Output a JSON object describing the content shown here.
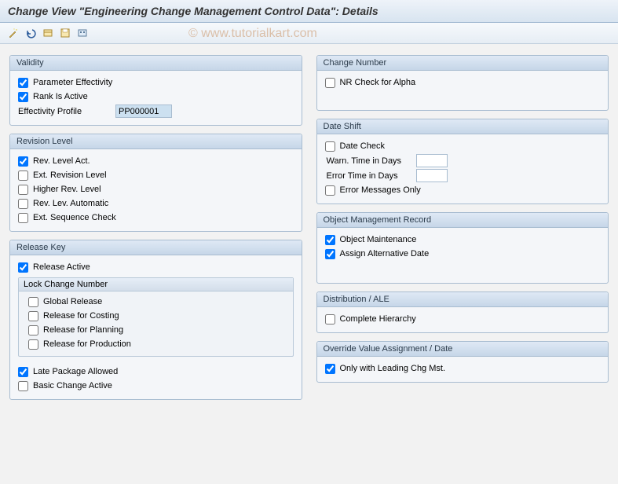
{
  "title": "Change View \"Engineering Change Management Control Data\": Details",
  "watermark": "© www.tutorialkart.com",
  "toolbar_icons": [
    "wand-icon",
    "undo-icon",
    "box-icon",
    "save-icon",
    "config-icon"
  ],
  "left": {
    "validity": {
      "header": "Validity",
      "param_effectivity": "Parameter Effectivity",
      "rank_active": "Rank Is Active",
      "eff_profile_label": "Effectivity Profile",
      "eff_profile_value": "PP000001"
    },
    "revision": {
      "header": "Revision Level",
      "rev_level_act": "Rev. Level Act.",
      "ext_rev_level": "Ext. Revision Level",
      "higher_rev": "Higher Rev. Level",
      "rev_auto": "Rev. Lev. Automatic",
      "ext_seq": "Ext. Sequence Check"
    },
    "release": {
      "header": "Release Key",
      "release_active": "Release Active",
      "lock_header": "Lock Change Number",
      "global_release": "Global Release",
      "rel_costing": "Release for Costing",
      "rel_planning": "Release for Planning",
      "rel_production": "Release for Production",
      "late_pkg": "Late Package Allowed",
      "basic_change": "Basic Change Active"
    }
  },
  "right": {
    "change_number": {
      "header": "Change Number",
      "nr_check": "NR Check for Alpha"
    },
    "date_shift": {
      "header": "Date Shift",
      "date_check": "Date Check",
      "warn_label": "Warn. Time in Days",
      "warn_value": "",
      "error_label": "Error Time in Days",
      "error_value": "",
      "error_msg_only": "Error Messages Only"
    },
    "omr": {
      "header": "Object Management Record",
      "obj_maint": "Object Maintenance",
      "assign_alt": "Assign Alternative Date"
    },
    "distribution": {
      "header": "Distribution / ALE",
      "complete_hier": "Complete Hierarchy"
    },
    "override": {
      "header": "Override Value Assignment / Date",
      "only_leading": "Only with Leading Chg Mst."
    }
  }
}
